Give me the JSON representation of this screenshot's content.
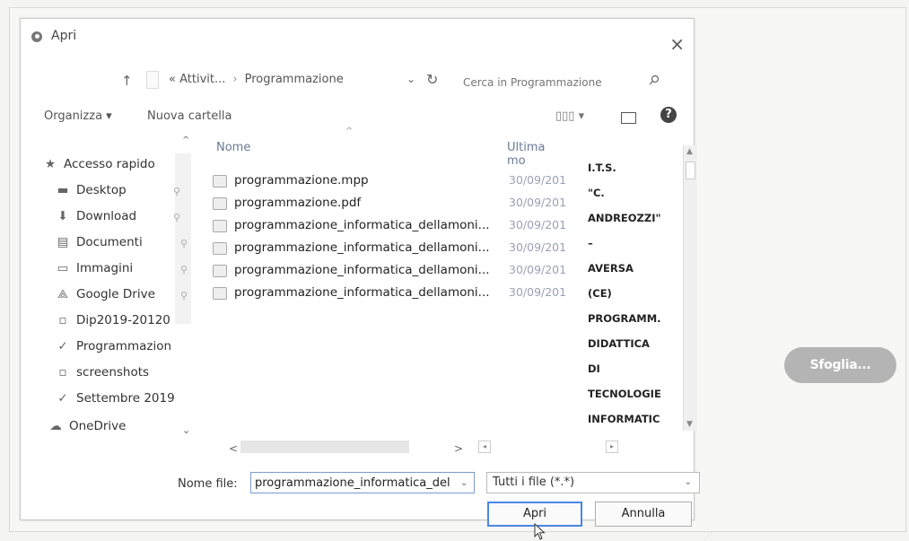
{
  "dialog": {
    "title": "Apri",
    "close_glyph": "×",
    "address": {
      "prefix": "«",
      "parent": "Attivit...",
      "separator": "›",
      "current": "Programmazione",
      "search_placeholder": "Cerca in Programmazione"
    },
    "toolbar": {
      "organize_label": "Organizza ▾",
      "new_folder_label": "Nuova cartella",
      "view_label": "▯▯▯ ▾",
      "help_label": "?"
    },
    "nav": {
      "items": [
        {
          "label": "Accesso rapido",
          "icon": "star-icon",
          "glyph": "★"
        },
        {
          "label": "Desktop",
          "icon": "desktop-icon",
          "glyph": "▬",
          "pinned": true
        },
        {
          "label": "Download",
          "icon": "download-icon",
          "glyph": "⬇",
          "pinned": true
        },
        {
          "label": "Documenti",
          "icon": "documents-icon",
          "glyph": "▤",
          "pinned": true
        },
        {
          "label": "Immagini",
          "icon": "pictures-icon",
          "glyph": "▭",
          "pinned": true
        },
        {
          "label": "Google Drive",
          "icon": "google-drive-icon",
          "glyph": "⟁",
          "pinned": true
        },
        {
          "label": "Dip2019-20120",
          "icon": "folder-icon",
          "glyph": "▫"
        },
        {
          "label": "Programmazion",
          "icon": "check-folder-icon",
          "glyph": "✓"
        },
        {
          "label": "screenshots",
          "icon": "folder-icon",
          "glyph": "▫"
        },
        {
          "label": "Settembre 2019",
          "icon": "check-folder-icon",
          "glyph": "✓"
        },
        {
          "label": "OneDrive",
          "icon": "cloud-icon",
          "glyph": "☁"
        }
      ]
    },
    "files": {
      "headers": {
        "name": "Nome",
        "date": "Ultima mo"
      },
      "rows": [
        {
          "name": "programmazione.mpp",
          "date": "30/09/201"
        },
        {
          "name": "programmazione.pdf",
          "date": "30/09/201"
        },
        {
          "name": "programmazione_informatica_dellamoni...",
          "date": "30/09/201"
        },
        {
          "name": "programmazione_informatica_dellamoni...",
          "date": "30/09/201"
        },
        {
          "name": "programmazione_informatica_dellamoni...",
          "date": "30/09/201"
        },
        {
          "name": "programmazione_informatica_dellamoni...",
          "date": "30/09/201"
        }
      ]
    },
    "preview_text": [
      "I.T.S.",
      "\"C.",
      "ANDREOZZI\"",
      "–",
      "AVERSA",
      "(CE)",
      "PROGRAMM.",
      "DIDATTICA",
      "DI",
      "TECNOLOGIE",
      "INFORMATIC"
    ],
    "footer": {
      "filename_label": "Nome file:",
      "filename_value": "programmazione_informatica_del",
      "filetype_value": "Tutti i file (*.*)",
      "open_label": "Apri",
      "cancel_label": "Annulla"
    }
  },
  "page": {
    "browse_button_label": "Sfoglia..."
  }
}
